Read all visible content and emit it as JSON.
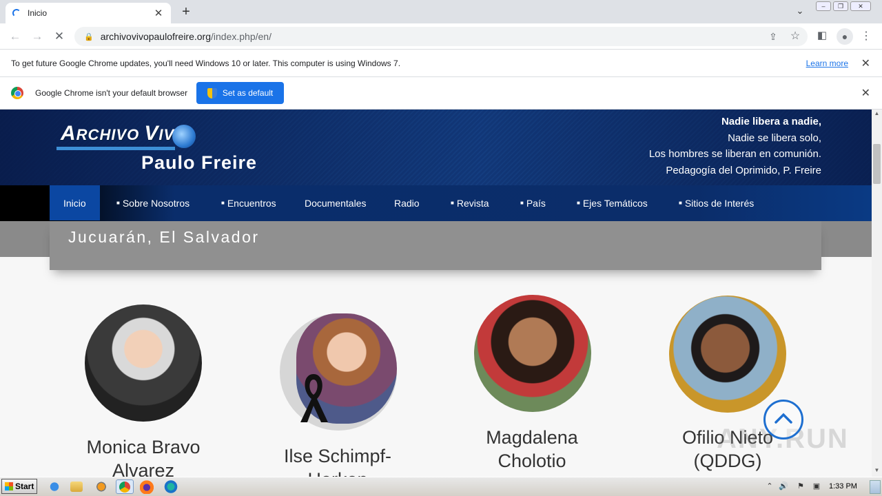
{
  "browser": {
    "tab_title": "Inicio",
    "url_host": "archivovivopaulofreire.org",
    "url_path": "/index.php/en/",
    "new_tab_symbol": "+",
    "tab_close_symbol": "✕"
  },
  "infobar_update": {
    "message": "To get future Google Chrome updates, you'll need Windows 10 or later. This computer is using Windows 7.",
    "link": "Learn more"
  },
  "infobar_default": {
    "message": "Google Chrome isn't your default browser",
    "button": "Set as default"
  },
  "site": {
    "logo_line1_big": "A",
    "logo_line1_rest": "RCHIVO ",
    "logo_line1_big2": "V",
    "logo_line1_rest2": "IVO",
    "logo_line2": "Paulo Freire",
    "quote": [
      "Nadie libera a nadie,",
      "Nadie se libera solo,",
      "Los hombres se liberan en comunión.",
      "Pedagogía del Oprimido,  P. Freire"
    ],
    "nav": [
      {
        "label": "Inicio",
        "bullet": ""
      },
      {
        "label": "Sobre Nosotros",
        "bullet": "■"
      },
      {
        "label": "Encuentros",
        "bullet": "■"
      },
      {
        "label": "Documentales",
        "bullet": ""
      },
      {
        "label": "Radio",
        "bullet": ""
      },
      {
        "label": "Revista",
        "bullet": "■"
      },
      {
        "label": "País",
        "bullet": "■"
      },
      {
        "label": "Ejes Temáticos",
        "bullet": "■"
      },
      {
        "label": "Sitios de Interés",
        "bullet": "■"
      }
    ],
    "page_title": "Jucuarán, El Salvador",
    "people": [
      {
        "name_line1": "Monica Bravo",
        "name_line2": "Alvarez"
      },
      {
        "name_line1": "Ilse Schimpf-",
        "name_line2": "Herken"
      },
      {
        "name_line1": "Magdalena",
        "name_line2": "Cholotio"
      },
      {
        "name_line1": "Ofilio Nieto",
        "name_line2": "(QDDG)"
      }
    ],
    "watermark": "ANY.RUN"
  },
  "taskbar": {
    "start": "Start",
    "clock": "1:33 PM"
  },
  "colors": {
    "accent": "#1a73e8",
    "banner": "#0f3270",
    "nav_active": "#0b47a2",
    "title_box": "#909090"
  }
}
